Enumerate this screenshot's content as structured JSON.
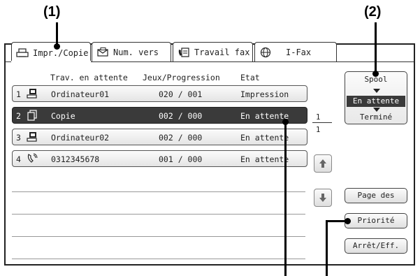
{
  "callouts": {
    "c1": "(1)",
    "c2": "(2)"
  },
  "tabs": [
    {
      "label": "Impr./Copie",
      "icon": "printer-icon",
      "active": true
    },
    {
      "label": "Num. vers",
      "icon": "scan-icon",
      "active": false
    },
    {
      "label": "Travail fax",
      "icon": "fax-icon",
      "active": false
    },
    {
      "label": "I-Fax",
      "icon": "internet-fax-icon",
      "active": false
    }
  ],
  "columns": {
    "job": "Trav. en attente",
    "sets": "Jeux/Progression",
    "status": "Etat"
  },
  "jobs": [
    {
      "num": "1",
      "icon": "computer-icon",
      "name": "Ordinateur01",
      "progress": "020 / 001",
      "status": "Impression",
      "selected": false
    },
    {
      "num": "2",
      "icon": "copy-icon",
      "name": "Copie",
      "progress": "002 / 000",
      "status": "En attente",
      "selected": true
    },
    {
      "num": "3",
      "icon": "computer-icon",
      "name": "Ordinateur02",
      "progress": "002 / 000",
      "status": "En attente",
      "selected": false
    },
    {
      "num": "4",
      "icon": "phone-icon",
      "name": "0312345678",
      "progress": "001 / 000",
      "status": "En attente",
      "selected": false
    }
  ],
  "page": {
    "current": "1",
    "total": "1"
  },
  "spool": {
    "top": "Spool",
    "middle": "En attente",
    "bottom": "Terminé"
  },
  "buttons": {
    "page_details": "Page des",
    "priority": "Priorité",
    "stop_delete": "Arrêt/Eff."
  },
  "colors": {
    "selected_bg": "#3a3a3a",
    "button_bg": "#e4e4e4"
  }
}
